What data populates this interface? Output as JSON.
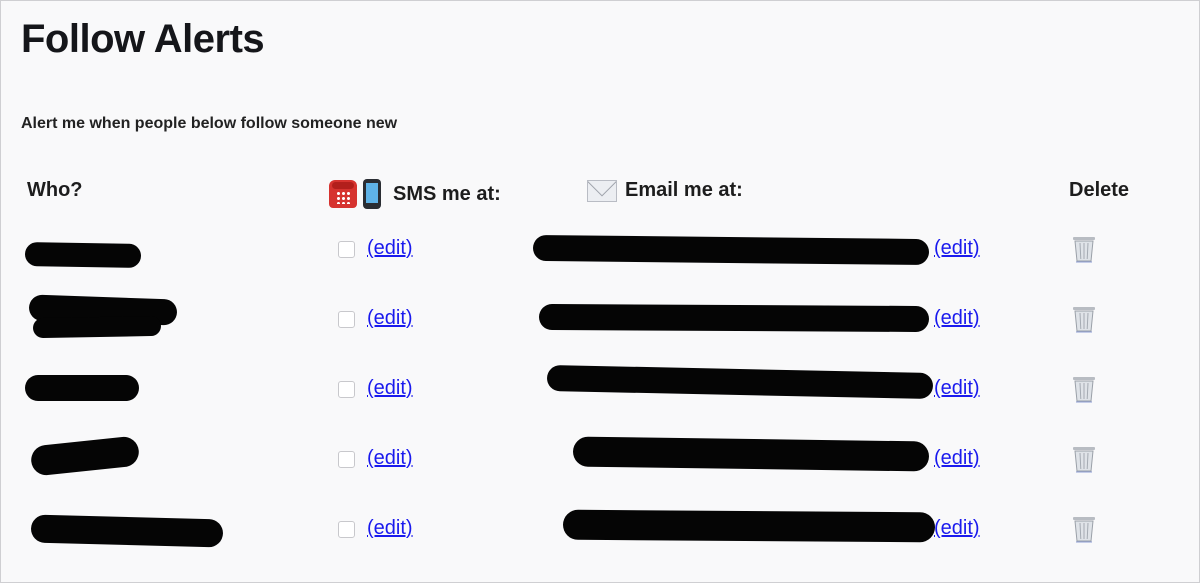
{
  "page": {
    "title": "Follow Alerts",
    "subtitle": "Alert me when people below follow someone new"
  },
  "columns": {
    "who": "Who?",
    "sms": "SMS me at:",
    "email": "Email me at:",
    "delete": "Delete"
  },
  "icons": {
    "sms": [
      "telephone-icon",
      "mobile-phone-icon"
    ],
    "email": "envelope-icon",
    "delete": "trash-icon"
  },
  "rows": [
    {
      "who": "[redacted]",
      "sms_checked": false,
      "sms_edit": "(edit)",
      "email": "[redacted]",
      "email_edit": "(edit)"
    },
    {
      "who": "[redacted]",
      "sms_checked": false,
      "sms_edit": "(edit)",
      "email": "[redacted]",
      "email_edit": "(edit)"
    },
    {
      "who": "[redacted]",
      "sms_checked": false,
      "sms_edit": "(edit)",
      "email": "[redacted]",
      "email_edit": "(edit)"
    },
    {
      "who": "[redacted]",
      "sms_checked": false,
      "sms_edit": "(edit)",
      "email": "[redacted]",
      "email_edit": "(edit)"
    },
    {
      "who": "[redacted]",
      "sms_checked": false,
      "sms_edit": "(edit)",
      "email": "[redacted]",
      "email_edit": "(edit)"
    }
  ],
  "colors": {
    "link": "#1a1aee",
    "redaction": "#050505",
    "background": "#f9f9fa"
  }
}
